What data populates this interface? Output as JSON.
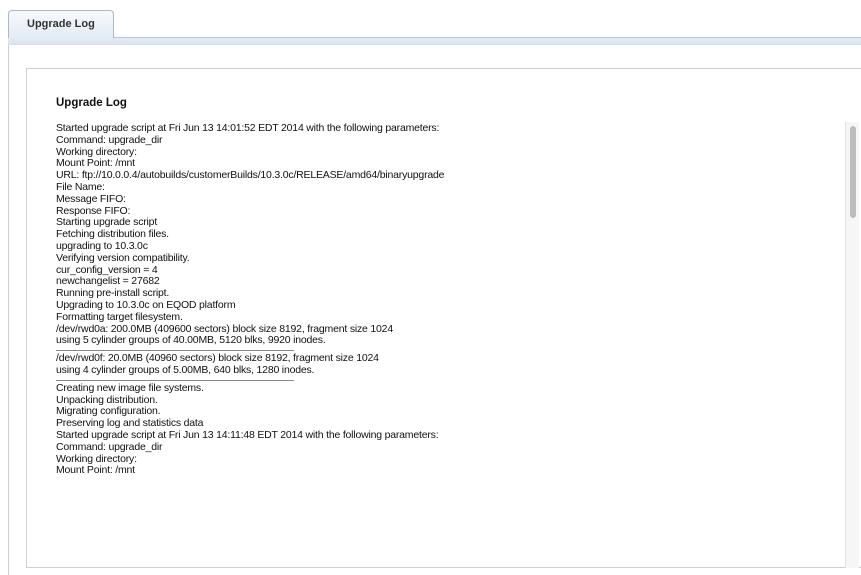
{
  "tabs": [
    {
      "label": "Upgrade Log",
      "active": true
    }
  ],
  "log": {
    "title": "Upgrade Log",
    "lines": [
      "Started upgrade script at Fri Jun 13 14:01:52 EDT 2014 with the following parameters:",
      "Command: upgrade_dir",
      "Working directory:",
      "Mount Point: /mnt",
      "URL: ftp://10.0.0.4/autobuilds/customerBuilds/10.3.0c/RELEASE/amd64/binaryupgrade",
      "File Name:",
      "Message FIFO:",
      "Response FIFO:",
      "Starting upgrade script",
      "Fetching distribution files.",
      "upgrading to 10.3.0c",
      "Verifying version compatibility.",
      "cur_config_version = 4",
      "newchangelist = 27682",
      "Running pre-install script.",
      "Upgrading to 10.3.0c on EQOD platform",
      "Formatting target filesystem.",
      "/dev/rwd0a: 200.0MB (409600 sectors) block size 8192, fragment size 1024",
      "using 5 cylinder groups of 40.00MB, 5120 blks, 9920 inodes.",
      "----",
      "/dev/rwd0f: 20.0MB (40960 sectors) block size 8192, fragment size 1024",
      "using 4 cylinder groups of 5.00MB, 640 blks, 1280 inodes.",
      "----",
      "Creating new image file systems.",
      "Unpacking distribution.",
      "Migrating configuration.",
      "Preserving log and statistics data",
      "Started upgrade script at Fri Jun 13 14:11:48 EDT 2014 with the following parameters:",
      "Command: upgrade_dir",
      "Working directory:",
      "Mount Point: /mnt"
    ]
  },
  "colors": {
    "tab_border": "#a9b8cc",
    "tab_bar": "#d6e0ee",
    "text": "#111111"
  }
}
